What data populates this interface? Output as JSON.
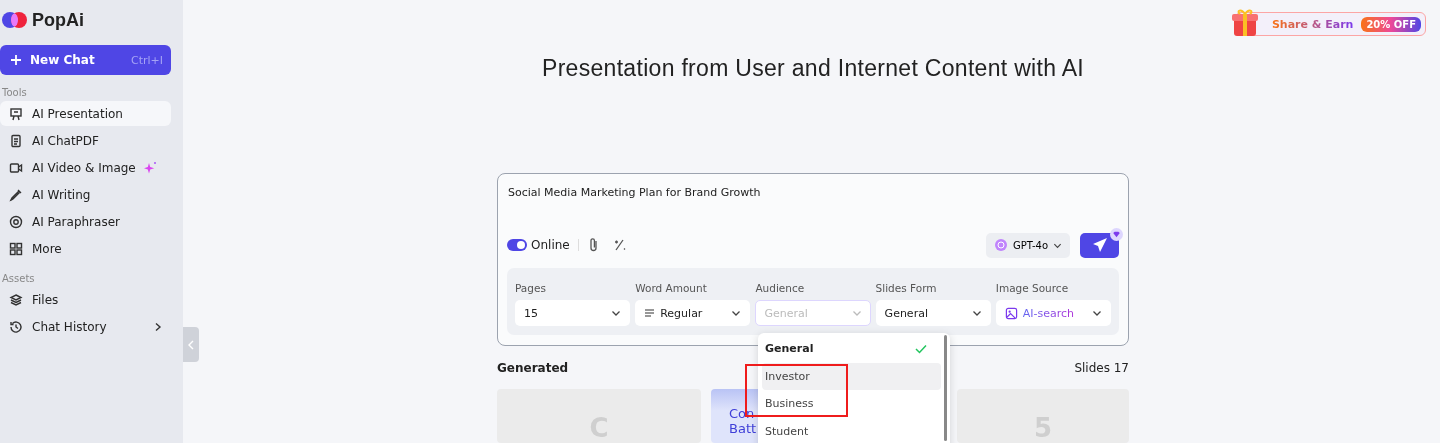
{
  "brand": "PopAi",
  "new_chat": {
    "label": "New Chat",
    "shortcut": "Ctrl+I"
  },
  "sidebar": {
    "sections": [
      {
        "title": "Tools",
        "items": [
          {
            "label": "AI Presentation",
            "selected": true
          },
          {
            "label": "AI ChatPDF",
            "selected": false
          },
          {
            "label": "AI Video & Image",
            "selected": false,
            "sparkle": true
          },
          {
            "label": "AI Writing",
            "selected": false
          },
          {
            "label": "AI Paraphraser",
            "selected": false
          },
          {
            "label": "More",
            "selected": false
          }
        ]
      },
      {
        "title": "Assets",
        "items": [
          {
            "label": "Files",
            "selected": false
          },
          {
            "label": "Chat History",
            "selected": false,
            "chevron": true
          }
        ]
      }
    ]
  },
  "promo": {
    "label": "Share & Earn",
    "badge": "20% OFF"
  },
  "title": "Presentation from User and Internet Content with AI",
  "prompt": {
    "value": "Social Media Marketing Plan for Brand Growth",
    "online": {
      "label": "Online",
      "on": true
    },
    "model": "GPT-4o"
  },
  "options": [
    {
      "label": "Pages",
      "value": "15",
      "open": false
    },
    {
      "label": "Word Amount",
      "value": "Regular",
      "open": false
    },
    {
      "label": "Audience",
      "value": "General",
      "open": true
    },
    {
      "label": "Slides Form",
      "value": "General",
      "open": false
    },
    {
      "label": "Image Source",
      "value": "AI-search",
      "open": false
    }
  ],
  "dropdown": [
    {
      "label": "General",
      "selected": true,
      "hovered": false,
      "highlighted": false
    },
    {
      "label": "Investor",
      "selected": false,
      "hovered": true,
      "highlighted": true
    },
    {
      "label": "Business",
      "selected": false,
      "hovered": false,
      "highlighted": true
    },
    {
      "label": "Student",
      "selected": false,
      "hovered": false,
      "highlighted": false
    }
  ],
  "generated": {
    "title": "Generated",
    "count": "Slides 17",
    "cards": [
      {
        "kind": "letter",
        "lines": [
          "C"
        ]
      },
      {
        "kind": "title",
        "lines": [
          "Con",
          "Batt"
        ]
      },
      {
        "kind": "letter",
        "lines": [
          "5"
        ]
      }
    ]
  }
}
